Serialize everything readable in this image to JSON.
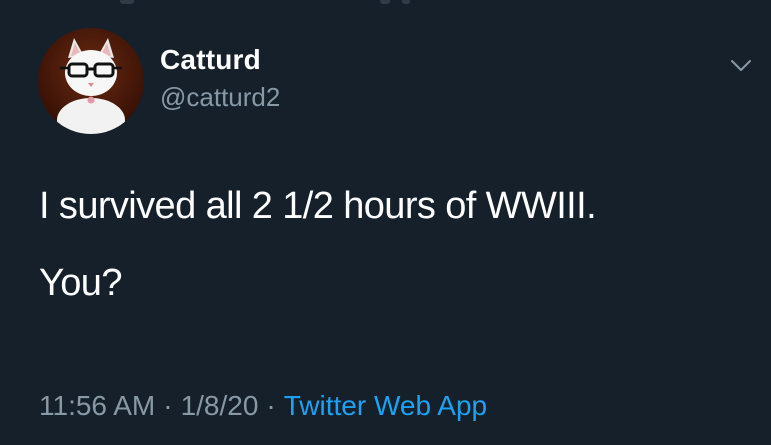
{
  "tweet": {
    "author": {
      "display_name": "Catturd",
      "handle": "@catturd2",
      "avatar_icon": "avatar-cat-with-glasses"
    },
    "text_lines": [
      "I survived all 2 1/2 hours of WWIII.",
      "You?"
    ],
    "time": "11:56 AM",
    "date": "1/8/20",
    "separator": "·",
    "source": "Twitter Web App",
    "menu_icon": "chevron-down-icon"
  },
  "colors": {
    "background": "#15202b",
    "primary_text": "#ffffff",
    "secondary_text": "#8899a6",
    "accent": "#1da1f2"
  }
}
